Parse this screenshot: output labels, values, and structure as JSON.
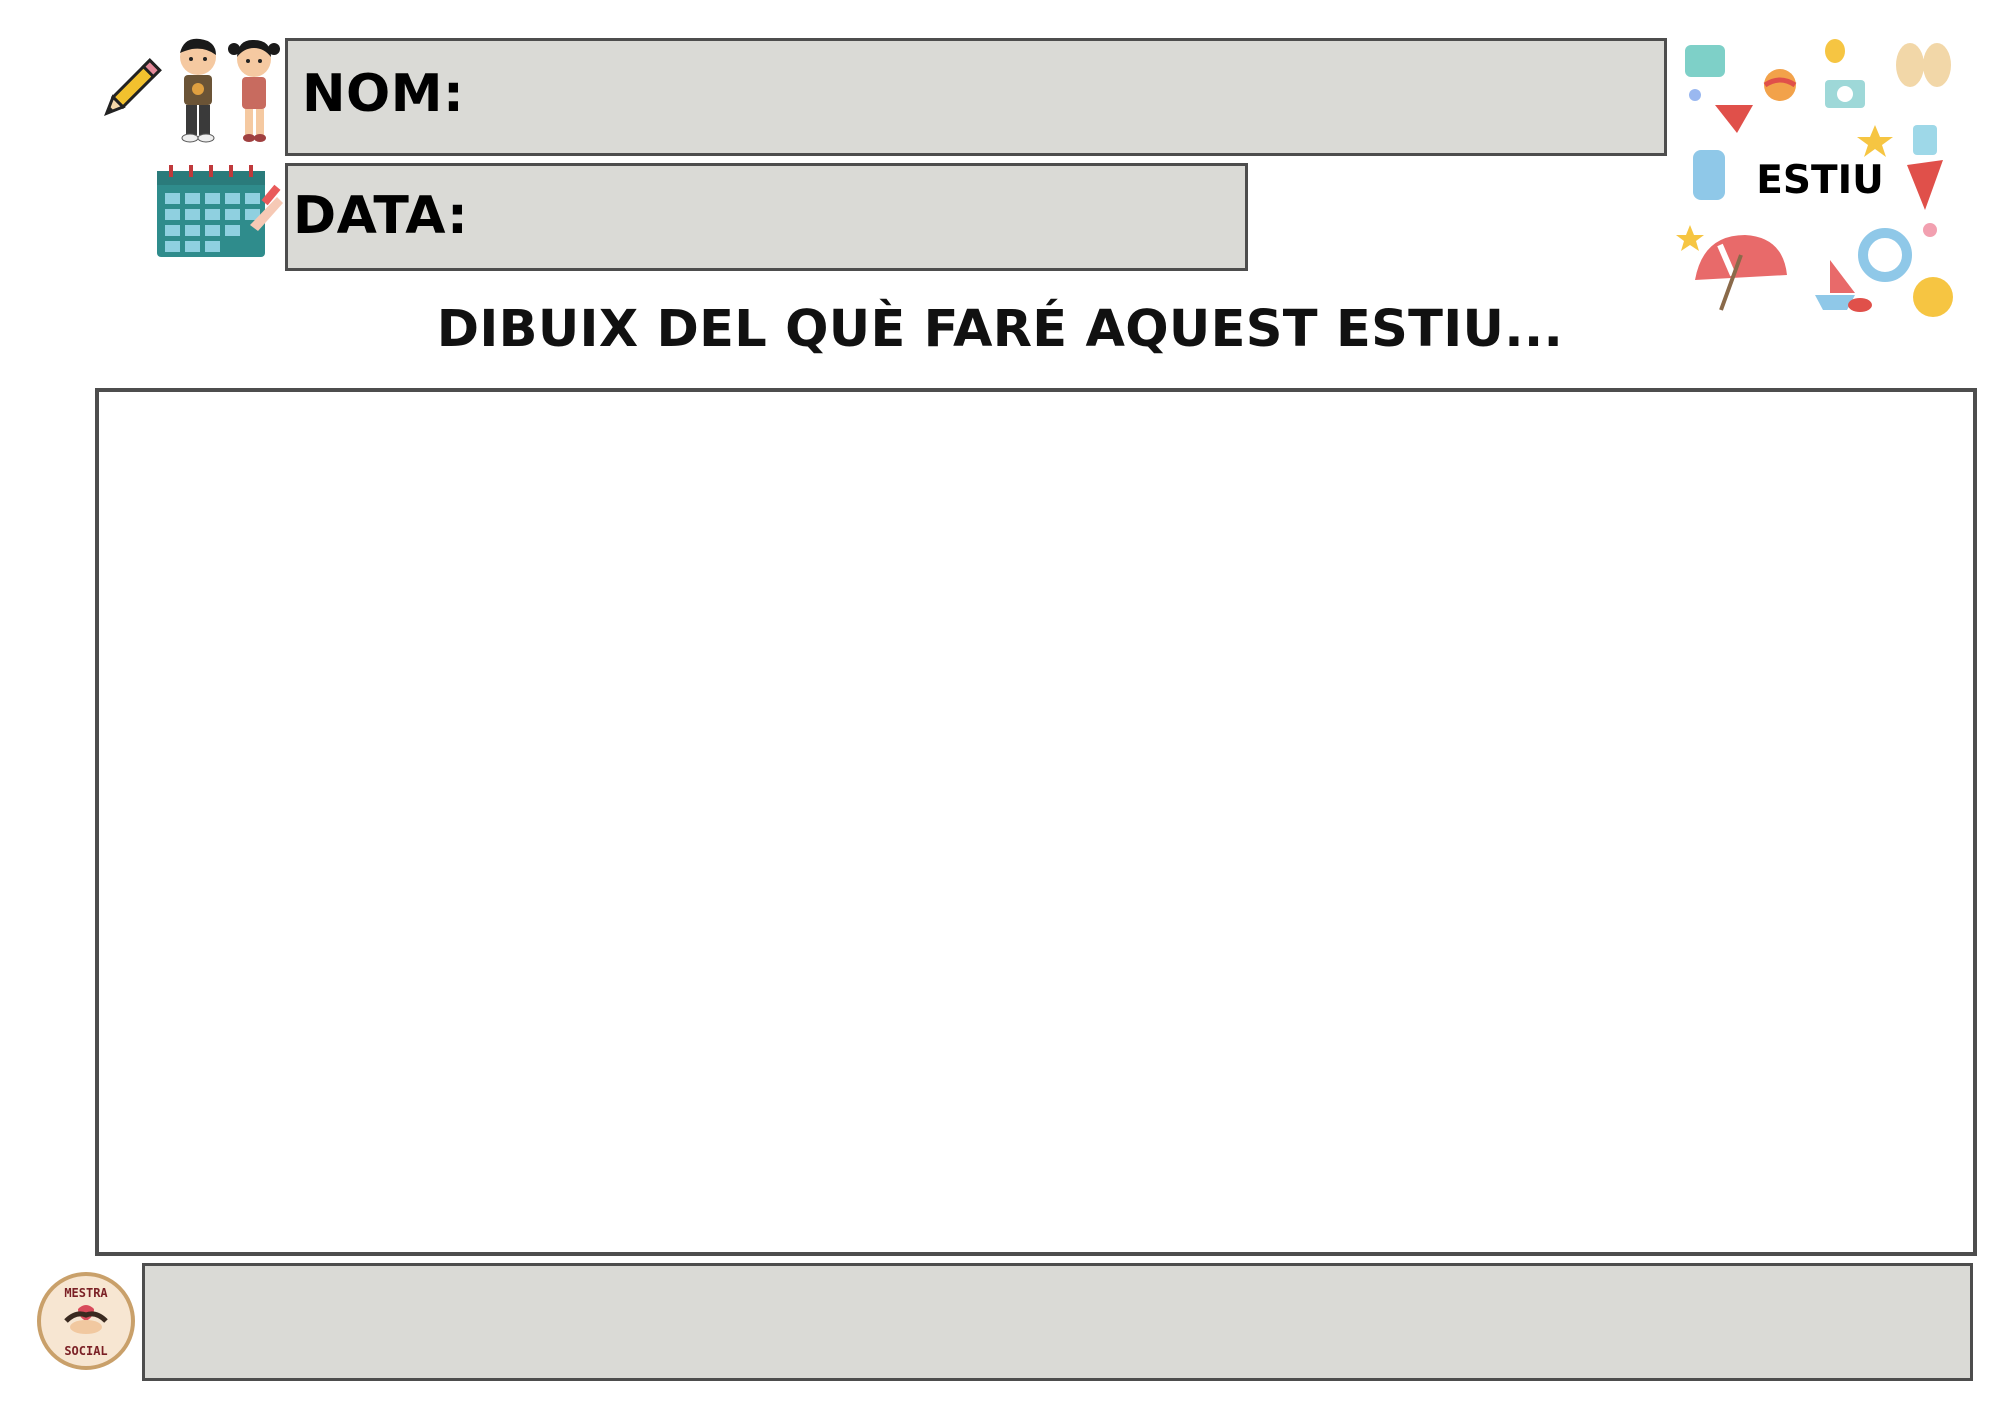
{
  "header": {
    "name_label": "NOM:",
    "date_label": "DATA:"
  },
  "title": "DIBUIX DEL QUÈ FARÉ AQUEST ESTIU...",
  "season_badge": {
    "text": "ESTIU"
  },
  "logo": {
    "top_text": "MESTRA",
    "bottom_text": "SOCIAL"
  },
  "colors": {
    "field_fill": "#dadad6",
    "border": "#4d4d4d",
    "calendar": "#2f8c8c"
  }
}
